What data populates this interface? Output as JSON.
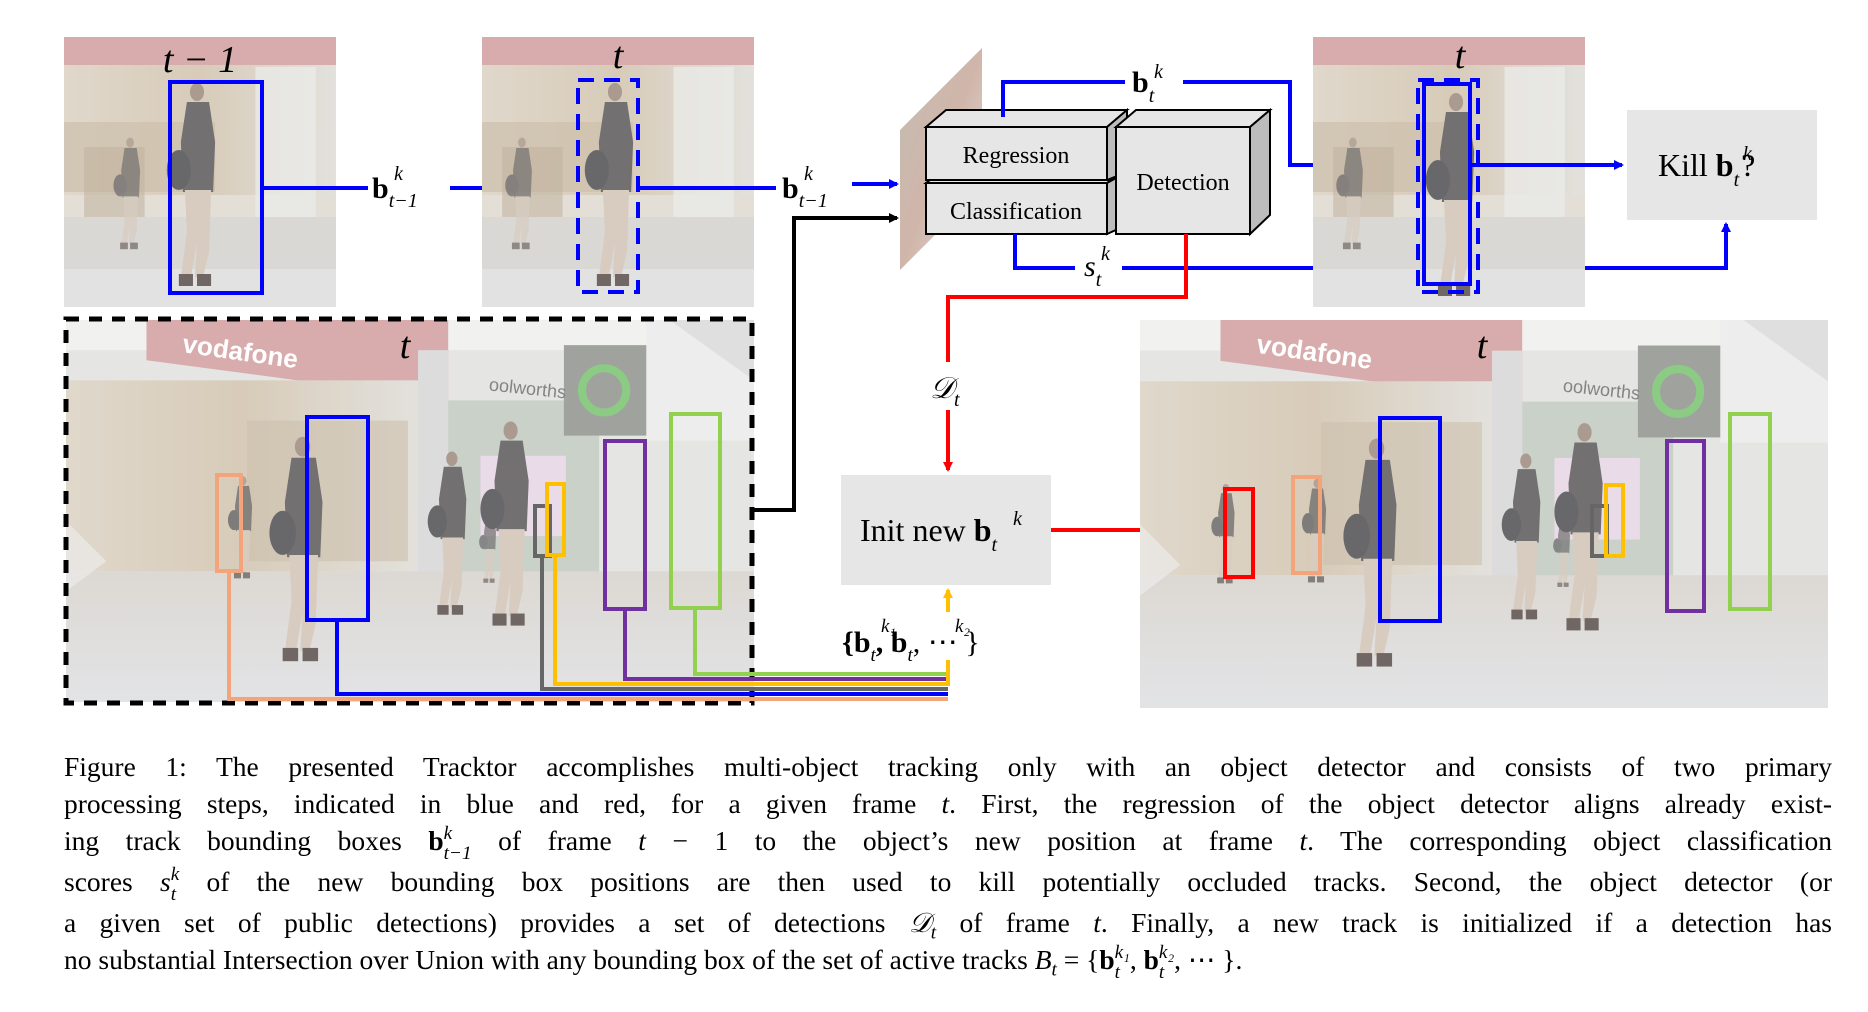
{
  "figure": {
    "frames": {
      "prev_frame_label": "t − 1",
      "cur_frame_label": "t",
      "main_frame_label": "t",
      "regressed_frame_label": "t",
      "output_frame_label": "t"
    },
    "labels": {
      "b_prev": "b",
      "b_prev_sup": "k",
      "b_prev_sub": "t−1",
      "b_cur": "b",
      "b_cur_sup": "k",
      "b_cur_sub": "t",
      "s_cur": "s",
      "s_cur_sup": "k",
      "s_cur_sub": "t",
      "d_cur": "𝒟",
      "d_cur_sub": "t",
      "active_set_prefix": "{b",
      "active_set_sup1": "k₁",
      "active_set_sub1": "t",
      "active_set_mid": ", b",
      "active_set_sup2": "k₂",
      "active_set_sub2": "t",
      "active_set_suffix": ", ⋯ }"
    },
    "modules": {
      "regression": "Regression",
      "classification": "Classification",
      "detection": "Detection"
    },
    "boxes": {
      "kill_prefix": "Kill ",
      "kill_b": "b",
      "kill_sup": "k",
      "kill_sub": "t",
      "kill_suffix": "?",
      "init_prefix": "Init new ",
      "init_b": "b",
      "init_sup": "k",
      "init_sub": "t"
    },
    "signs": {
      "vodafone": "vodafone",
      "woolworths": "oolworths"
    },
    "colors": {
      "blue": "#0000ff",
      "red": "#ff0000",
      "black": "#000000",
      "orange": "#f4a47a",
      "gray": "#666666",
      "yellow": "#ffc000",
      "purple": "#7030a0",
      "green": "#92d050",
      "box_fill": "#e6e6e6"
    },
    "track_colors_order": [
      "green",
      "purple",
      "yellow",
      "gray",
      "blue",
      "orange"
    ]
  },
  "caption": {
    "lines": [
      "Figure 1: The presented Tracktor accomplishes multi-object tracking only with an object detector and consists of two primary",
      "processing steps, indicated in blue and red, for a given frame t. First, the regression of the object detector aligns already exist-",
      "ing track bounding boxes b_{t−1}^k of frame t − 1 to the object’s new position at frame t. The corresponding object classification",
      "scores s_t^k of the new bounding box positions are then used to kill potentially occluded tracks. Second, the object detector (or",
      "a given set of public detections) provides a set of detections 𝒟_t of frame t. Finally, a new track is initialized if a detection has",
      "no substantial Intersection over Union with any bounding box of the set of active tracks B_t = {b_t^{k1}, b_t^{k2}, ⋯ }."
    ],
    "parts": {
      "l1": "Figure 1: The presented Tracktor accomplishes multi-object tracking only with an object detector and consists of two primary",
      "l2a": "processing steps, indicated in blue and red, for a given frame ",
      "l2t": "t",
      "l2b": ". First, the regression of the object detector aligns already exist-",
      "l3a": "ing track bounding boxes ",
      "l3b_b": "b",
      "l3b_sup": "k",
      "l3b_sub": "t−1",
      "l3c": " of frame ",
      "l3t": "t",
      "l3d": " − 1 to the object’s new position at frame ",
      "l3t2": "t",
      "l3e": ". The corresponding object classification",
      "l4a": "scores ",
      "l4s": "s",
      "l4sup": "k",
      "l4sub": "t",
      "l4b": " of the new bounding box positions are then used to kill potentially occluded tracks. Second, the object detector (or",
      "l5a": "a given set of public detections) provides a set of detections ",
      "l5d": "𝒟",
      "l5dsub": "t",
      "l5b": " of frame ",
      "l5t": "t",
      "l5c": ". Finally, a new track is initialized if a detection has",
      "l6a": "no substantial Intersection over Union with any bounding box of the set of active tracks ",
      "l6B": "B",
      "l6Bsub": "t",
      "l6b": " = {",
      "l6b1": "b",
      "l6sup1": "k₁",
      "l6sub1": "t",
      "l6c": ", ",
      "l6b2": "b",
      "l6sup2": "k₂",
      "l6sub2": "t",
      "l6d": ", ⋯ }."
    }
  }
}
